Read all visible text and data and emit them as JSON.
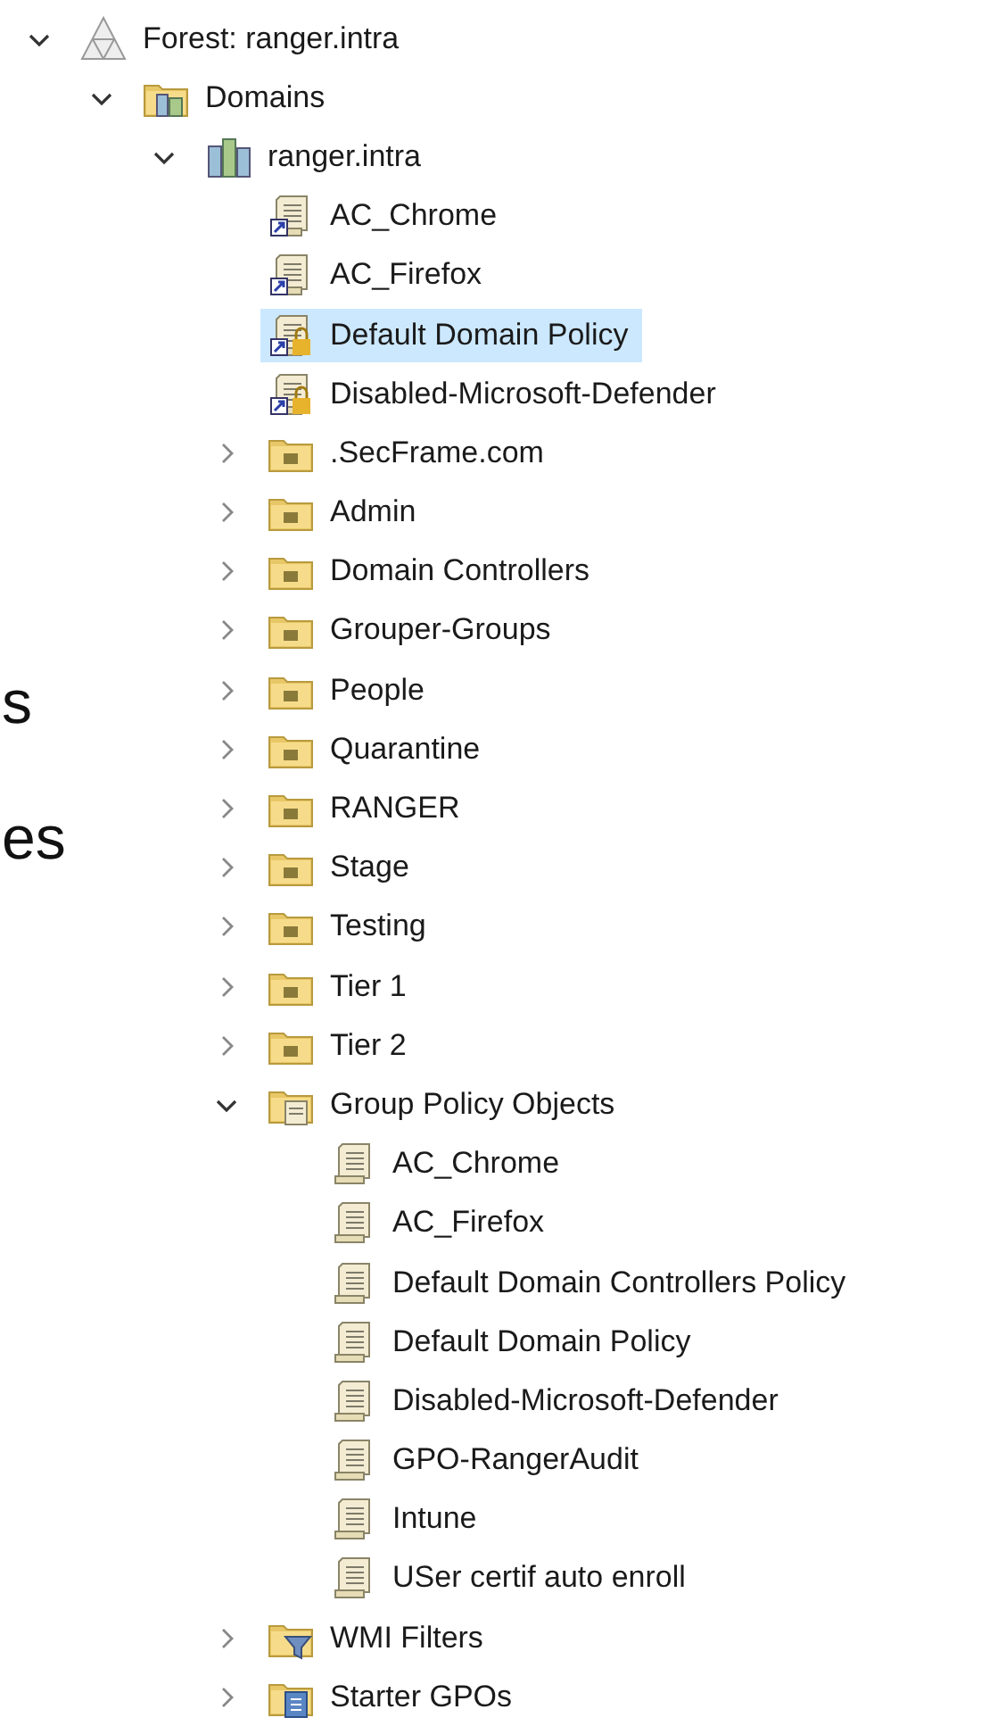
{
  "side_texts": [
    "s",
    "es"
  ],
  "tree": [
    {
      "label": "Forest: ranger.intra",
      "kind": "forest",
      "expanded": true,
      "selected": false,
      "children": [
        {
          "label": "Domains",
          "kind": "domains",
          "expanded": true,
          "selected": false,
          "children": [
            {
              "label": "ranger.intra",
              "kind": "domain",
              "expanded": true,
              "selected": false,
              "children": [
                {
                  "label": "AC_Chrome",
                  "kind": "gpo-link",
                  "selected": false
                },
                {
                  "label": "AC_Firefox",
                  "kind": "gpo-link",
                  "selected": false
                },
                {
                  "label": "Default Domain Policy",
                  "kind": "gpo-link-enforced",
                  "selected": true
                },
                {
                  "label": "Disabled-Microsoft-Defender",
                  "kind": "gpo-link-enforced",
                  "selected": false
                },
                {
                  "label": ".SecFrame.com",
                  "kind": "ou",
                  "expanded": false,
                  "selected": false
                },
                {
                  "label": "Admin",
                  "kind": "ou",
                  "expanded": false,
                  "selected": false
                },
                {
                  "label": "Domain Controllers",
                  "kind": "ou",
                  "expanded": false,
                  "selected": false
                },
                {
                  "label": "Grouper-Groups",
                  "kind": "ou",
                  "expanded": false,
                  "selected": false
                },
                {
                  "label": "People",
                  "kind": "ou",
                  "expanded": false,
                  "selected": false
                },
                {
                  "label": "Quarantine",
                  "kind": "ou",
                  "expanded": false,
                  "selected": false
                },
                {
                  "label": "RANGER",
                  "kind": "ou",
                  "expanded": false,
                  "selected": false
                },
                {
                  "label": "Stage",
                  "kind": "ou",
                  "expanded": false,
                  "selected": false
                },
                {
                  "label": "Testing",
                  "kind": "ou",
                  "expanded": false,
                  "selected": false
                },
                {
                  "label": "Tier 1",
                  "kind": "ou",
                  "expanded": false,
                  "selected": false
                },
                {
                  "label": "Tier 2",
                  "kind": "ou",
                  "expanded": false,
                  "selected": false
                },
                {
                  "label": "Group Policy Objects",
                  "kind": "gpo-container",
                  "expanded": true,
                  "selected": false,
                  "children": [
                    {
                      "label": "AC_Chrome",
                      "kind": "gpo",
                      "selected": false
                    },
                    {
                      "label": "AC_Firefox",
                      "kind": "gpo",
                      "selected": false
                    },
                    {
                      "label": "Default Domain Controllers Policy",
                      "kind": "gpo",
                      "selected": false
                    },
                    {
                      "label": "Default Domain Policy",
                      "kind": "gpo",
                      "selected": false
                    },
                    {
                      "label": "Disabled-Microsoft-Defender",
                      "kind": "gpo",
                      "selected": false
                    },
                    {
                      "label": "GPO-RangerAudit",
                      "kind": "gpo",
                      "selected": false
                    },
                    {
                      "label": "Intune",
                      "kind": "gpo",
                      "selected": false
                    },
                    {
                      "label": "USer certif auto enroll",
                      "kind": "gpo",
                      "selected": false
                    }
                  ]
                },
                {
                  "label": "WMI Filters",
                  "kind": "wmi",
                  "expanded": false,
                  "selected": false
                },
                {
                  "label": "Starter GPOs",
                  "kind": "starter",
                  "expanded": false,
                  "selected": false
                }
              ]
            }
          ]
        }
      ]
    }
  ]
}
